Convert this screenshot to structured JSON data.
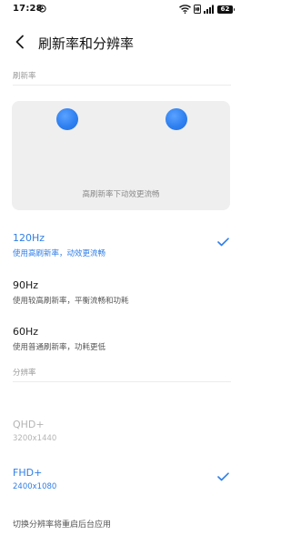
{
  "status_bar": {
    "time": "17:28",
    "battery": "62",
    "icons": [
      "clock-icon",
      "wifi-icon",
      "hd-icon",
      "signal-icon",
      "battery-icon"
    ]
  },
  "header": {
    "back_icon": "chevron-left-icon",
    "title": "刷新率和分辨率"
  },
  "refresh_section": {
    "label": "刷新率",
    "preview_caption": "高刷新率下动效更流畅",
    "options": [
      {
        "title": "120Hz",
        "subtitle": "使用高刷新率，动效更流畅",
        "selected": true
      },
      {
        "title": "90Hz",
        "subtitle": "使用较高刷新率，平衡流畅和功耗",
        "selected": false
      },
      {
        "title": "60Hz",
        "subtitle": "使用普通刷新率，功耗更低",
        "selected": false
      }
    ]
  },
  "resolution_section": {
    "label": "分辨率",
    "options": [
      {
        "title": "QHD+",
        "subtitle": "3200x1440",
        "selected": false,
        "disabled": true
      },
      {
        "title": "FHD+",
        "subtitle": "2400x1080",
        "selected": true,
        "disabled": false
      }
    ],
    "footer_note": "切换分辨率将重启后台应用"
  },
  "colors": {
    "accent": "#2f7ee8",
    "text_primary": "#1a1a1a",
    "text_secondary": "#555555",
    "section_label": "#9a9a9a",
    "card_bg": "#efefef"
  }
}
